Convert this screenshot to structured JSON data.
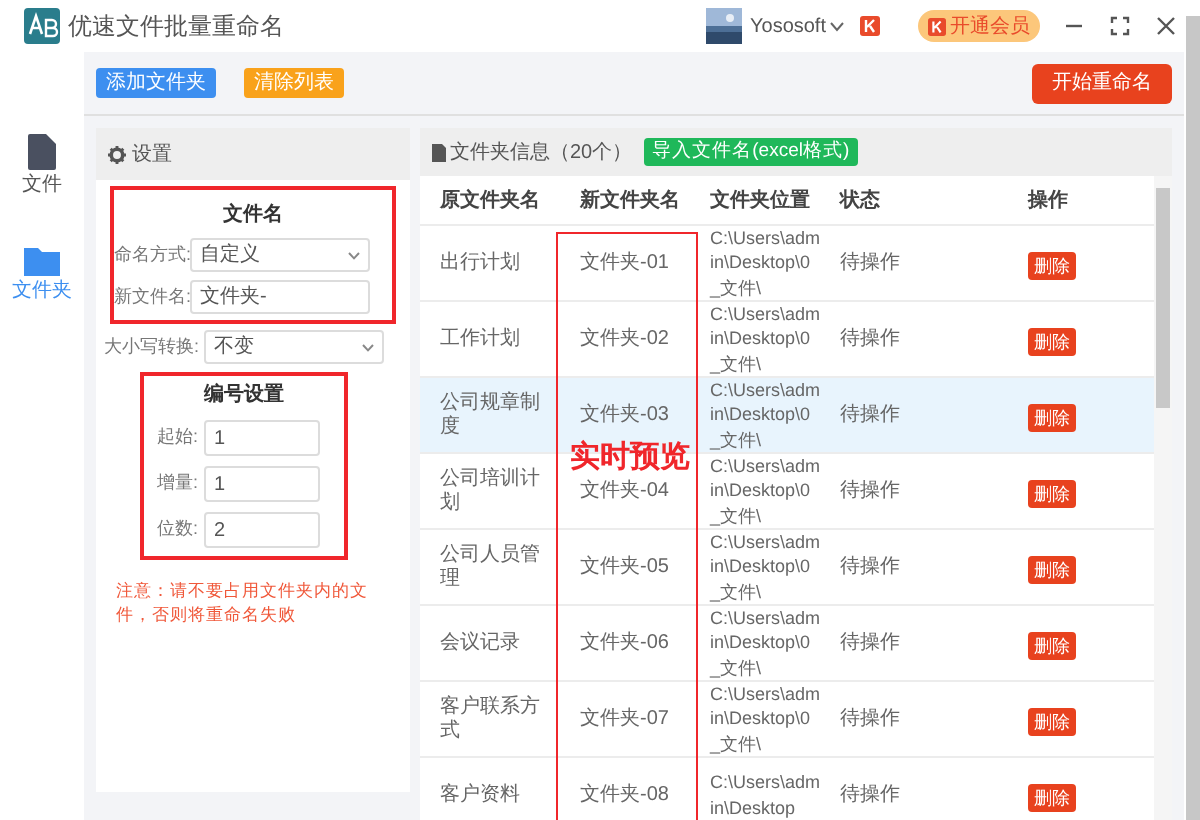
{
  "window": {
    "title": "优速文件批量重命名",
    "user": "Yososoft",
    "vip_button": "开通会员"
  },
  "toolbar": {
    "buttons": [
      {
        "label": "添加文件夹",
        "kind": "blue"
      },
      {
        "label": "清除列表",
        "kind": "orange"
      }
    ],
    "start_button": "开始重命名"
  },
  "nav": [
    {
      "label": "文件",
      "kind": "file",
      "selected": false
    },
    {
      "label": "文件夹",
      "kind": "folder",
      "selected": true
    }
  ],
  "settings": {
    "title": "设置",
    "filename_section": "文件名",
    "naming_mode": {
      "label": "命名方式:",
      "value": "自定义"
    },
    "new_name": {
      "label": "新文件名:",
      "value": "文件夹-"
    },
    "case": {
      "label": "大小写转换:",
      "value": "不变"
    },
    "numbering_section": "编号设置",
    "numbering": [
      {
        "label": "起始:",
        "value": "1"
      },
      {
        "label": "增量:",
        "value": "1"
      },
      {
        "label": "位数:",
        "value": "2"
      }
    ],
    "note": "注意：请不要占用文件夹内的文件，否则将重命名失败"
  },
  "list": {
    "title": "文件夹信息（20个）",
    "import_button": "导入文件名(excel格式)",
    "columns": [
      "原文件夹名",
      "新文件夹名",
      "文件夹位置",
      "状态",
      "操作"
    ],
    "rows": [
      {
        "original": "出行计划",
        "new": "文件夹-01",
        "location": "C:\\Users\\admin\\Desktop\\0_文件\\",
        "status": "待操作",
        "action": "删除",
        "selected": false
      },
      {
        "original": "工作计划",
        "new": "文件夹-02",
        "location": "C:\\Users\\admin\\Desktop\\0_文件\\",
        "status": "待操作",
        "action": "删除",
        "selected": false
      },
      {
        "original": "公司规章制度",
        "new": "文件夹-03",
        "location": "C:\\Users\\admin\\Desktop\\0_文件\\",
        "status": "待操作",
        "action": "删除",
        "selected": true
      },
      {
        "original": "公司培训计划",
        "new": "文件夹-04",
        "location": "C:\\Users\\admin\\Desktop\\0_文件\\",
        "status": "待操作",
        "action": "删除",
        "selected": false
      },
      {
        "original": "公司人员管理",
        "new": "文件夹-05",
        "location": "C:\\Users\\admin\\Desktop\\0_文件\\",
        "status": "待操作",
        "action": "删除",
        "selected": false
      },
      {
        "original": "会议记录",
        "new": "文件夹-06",
        "location": "C:\\Users\\admin\\Desktop\\0_文件\\",
        "status": "待操作",
        "action": "删除",
        "selected": false
      },
      {
        "original": "客户联系方式",
        "new": "文件夹-07",
        "location": "C:\\Users\\admin\\Desktop\\0_文件\\",
        "status": "待操作",
        "action": "删除",
        "selected": false
      },
      {
        "original": "客户资料",
        "new": "文件夹-08",
        "location": "C:\\Users\\admin\\Desktop",
        "status": "待操作",
        "action": "删除",
        "selected": false
      }
    ],
    "annotation": "实时预览"
  }
}
